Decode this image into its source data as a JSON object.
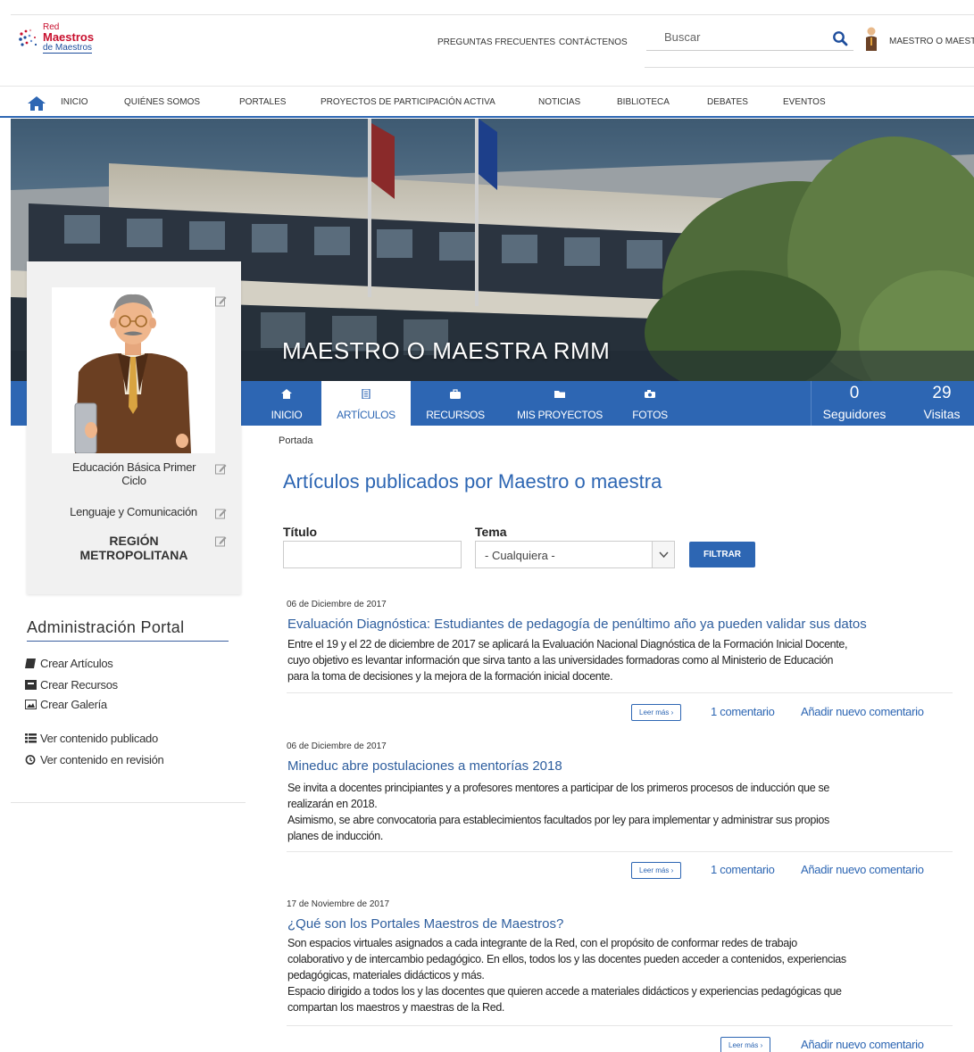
{
  "header": {
    "logo": {
      "line1": "Red",
      "line2": "Maestros",
      "line3": "de Maestros"
    },
    "links": [
      "PREGUNTAS FRECUENTES",
      "CONTÁCTENOS"
    ],
    "search_placeholder": "Buscar",
    "user_name": "MAESTRO O MAESTRA"
  },
  "nav": {
    "items": [
      "INICIO",
      "QUIÉNES SOMOS",
      "PORTALES",
      "PROYECTOS DE PARTICIPACIÓN ACTIVA",
      "NOTICIAS",
      "BIBLIOTECA",
      "DEBATES",
      "EVENTOS"
    ]
  },
  "banner": {
    "title": "MAESTRO O MAESTRA RMM"
  },
  "profile_tabs": [
    "INICIO",
    "ARTÍCULOS",
    "RECURSOS",
    "MIS PROYECTOS",
    "FOTOS"
  ],
  "active_tab": "ARTÍCULOS",
  "stats": [
    {
      "value": "0",
      "label": "Seguidores"
    },
    {
      "value": "29",
      "label": "Visitas"
    }
  ],
  "profile": {
    "level_line1": "Educación Básica Primer",
    "level_line2": "Ciclo",
    "subject": "Lenguaje y Comunicación",
    "region_line1": "REGIÓN",
    "region_line2": "METROPOLITANA"
  },
  "admin": {
    "title": "Administración Portal",
    "links": [
      "Crear Artículos",
      "Crear Recursos",
      "Crear Galería",
      "Ver contenido publicado",
      "Ver contenido en revisión"
    ]
  },
  "breadcrumb": "Portada",
  "content_title": "Artículos publicados por Maestro o maestra",
  "filters": {
    "titulo_label": "Título",
    "tema_label": "Tema",
    "tema_value": "- Cualquiera -",
    "button": "FILTRAR"
  },
  "articles": [
    {
      "date": "06 de Diciembre de 2017",
      "title": "Evaluación Diagnóstica: Estudiantes de pedagogía de penúltimo año ya pueden validar sus datos",
      "body": [
        "Entre el 19 y el 22 de diciembre de 2017 se aplicará la Evaluación Nacional Diagnóstica de la Formación Inicial Docente,",
        "cuyo objetivo es levantar información que sirva tanto a las universidades formadoras como al Ministerio de Educación",
        "para la toma de decisiones y la mejora de la formación inicial docente."
      ],
      "read_more": "Leer más",
      "comments": "1 comentario",
      "add_comment": "Añadir nuevo comentario"
    },
    {
      "date": "06 de Diciembre de 2017",
      "title": "Mineduc abre postulaciones a mentorías 2018",
      "body": [
        "Se invita a docentes principiantes y a profesores mentores a participar de los primeros procesos de inducción que se",
        "realizarán en 2018.",
        "Asimismo, se abre convocatoria para establecimientos facultados por ley para implementar y administrar sus propios",
        "planes de inducción."
      ],
      "read_more": "Leer más",
      "comments": "1 comentario",
      "add_comment": "Añadir nuevo comentario"
    },
    {
      "date": "17 de Noviembre de 2017",
      "title": "¿Qué son los Portales Maestros de Maestros?",
      "body": [
        "Son espacios virtuales asignados a cada integrante de la Red, con el propósito de conformar redes de trabajo",
        "colaborativo y de intercambio pedagógico. En ellos, todos los y las docentes pueden acceder a contenidos, experiencias",
        "pedagógicas, materiales didácticos y más.",
        "Espacio dirigido a todos los y las docentes que quieren accede a materiales didácticos y experiencias pedagógicas que",
        "compartan los maestros y maestras de la Red."
      ],
      "read_more": "Leer más",
      "add_comment": "Añadir nuevo comentario"
    }
  ],
  "colors": {
    "primary": "#2d66b3",
    "brand_red": "#c8102e"
  }
}
